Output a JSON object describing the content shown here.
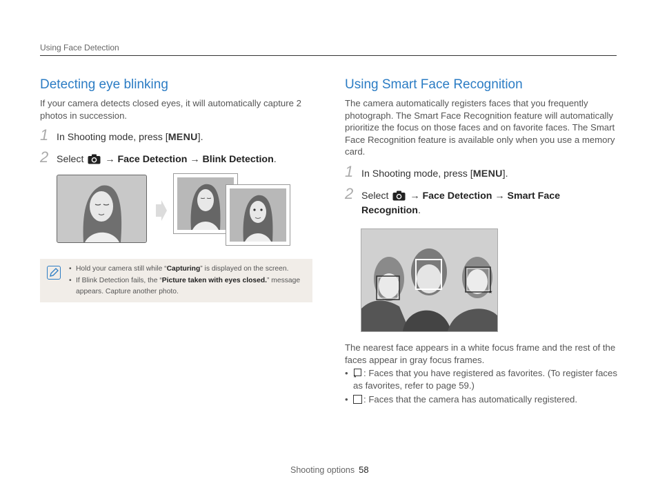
{
  "header": {
    "section": "Using Face Detection"
  },
  "left": {
    "title": "Detecting eye blinking",
    "intro": "If your camera detects closed eyes, it will automatically capture 2 photos in succession.",
    "step1": {
      "num": "1",
      "text": "In Shooting mode, press [",
      "key": "MENU",
      "end": "]."
    },
    "step2": {
      "num": "2",
      "select": "Select",
      "arrow": "→",
      "item1": "Face Detection",
      "item2": "Blink Detection",
      "end": "."
    },
    "note": {
      "line1_pre": "Hold your camera still while “",
      "line1_bold": "Capturing",
      "line1_post": "” is displayed on the screen.",
      "line2_pre": "If Blink Detection fails, the “",
      "line2_bold": "Picture taken with eyes closed.",
      "line2_post": "” message appears. Capture another photo."
    }
  },
  "right": {
    "title": "Using Smart Face Recognition",
    "intro": "The camera automatically registers faces that you frequently photograph. The Smart Face Recognition feature will automatically prioritize the focus on those faces and on favorite faces. The Smart Face Recognition feature is available only when you use a memory card.",
    "step1": {
      "num": "1",
      "text": "In Shooting mode, press [",
      "key": "MENU",
      "end": "]."
    },
    "step2": {
      "num": "2",
      "select": "Select",
      "arrow": "→",
      "item1": "Face Detection",
      "item2": "Smart Face Recognition",
      "end": "."
    },
    "caption": "The nearest face appears in a white focus frame and the rest of the faces appear in gray focus frames.",
    "bullet1": ": Faces that you have registered as favorites. (To register faces as favorites, refer to page 59.)",
    "bullet2": ": Faces that the camera has automatically registered."
  },
  "footer": {
    "label": "Shooting options",
    "page": "58"
  }
}
